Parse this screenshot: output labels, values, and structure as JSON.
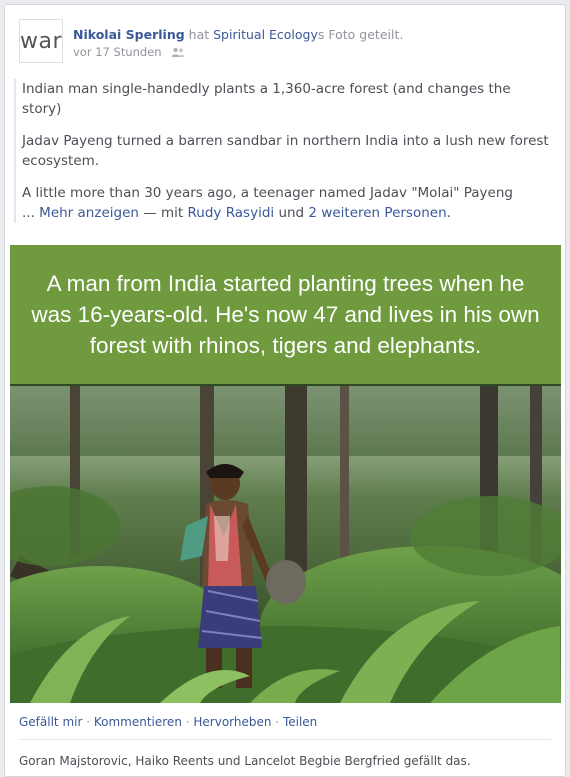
{
  "post": {
    "avatar_text": "war",
    "author": "Nikolai Sperling",
    "shared_verb": " hat ",
    "page": "Spiritual Ecology",
    "shared_tail": "s Foto geteilt.",
    "time": "vor 17 Stunden",
    "audience_icon": "friends-icon",
    "paragraphs": [
      "Indian man single-handedly plants a 1,360-acre forest (and changes the story)",
      "Jadav Payeng turned a barren sandbar in northern India into a lush new forest ecosystem.",
      "A little more than 30 years ago, a teenager named Jadav \"Molai\" Payeng"
    ],
    "more_prefix": "... ",
    "more_label": "Mehr anzeigen",
    "with_text": " — mit ",
    "tag1": "Rudy Rasyidi",
    "and_text": " und ",
    "tag2": "2 weiteren Personen",
    "tail": "."
  },
  "photo": {
    "banner_text": "A man from India started planting trees when he was 16-years-old. He's now 47 and lives in his own forest with rhinos, tigers and elephants.",
    "banner_color": "#6f9a3e"
  },
  "actions": {
    "like": "Gefällt mir",
    "comment": "Kommentieren",
    "highlight": "Hervorheben",
    "share": "Teilen",
    "sep": " · "
  },
  "likes_text": "Goran Majstorovic, Haiko Reents und Lancelot Begbie Bergfried gefällt das."
}
